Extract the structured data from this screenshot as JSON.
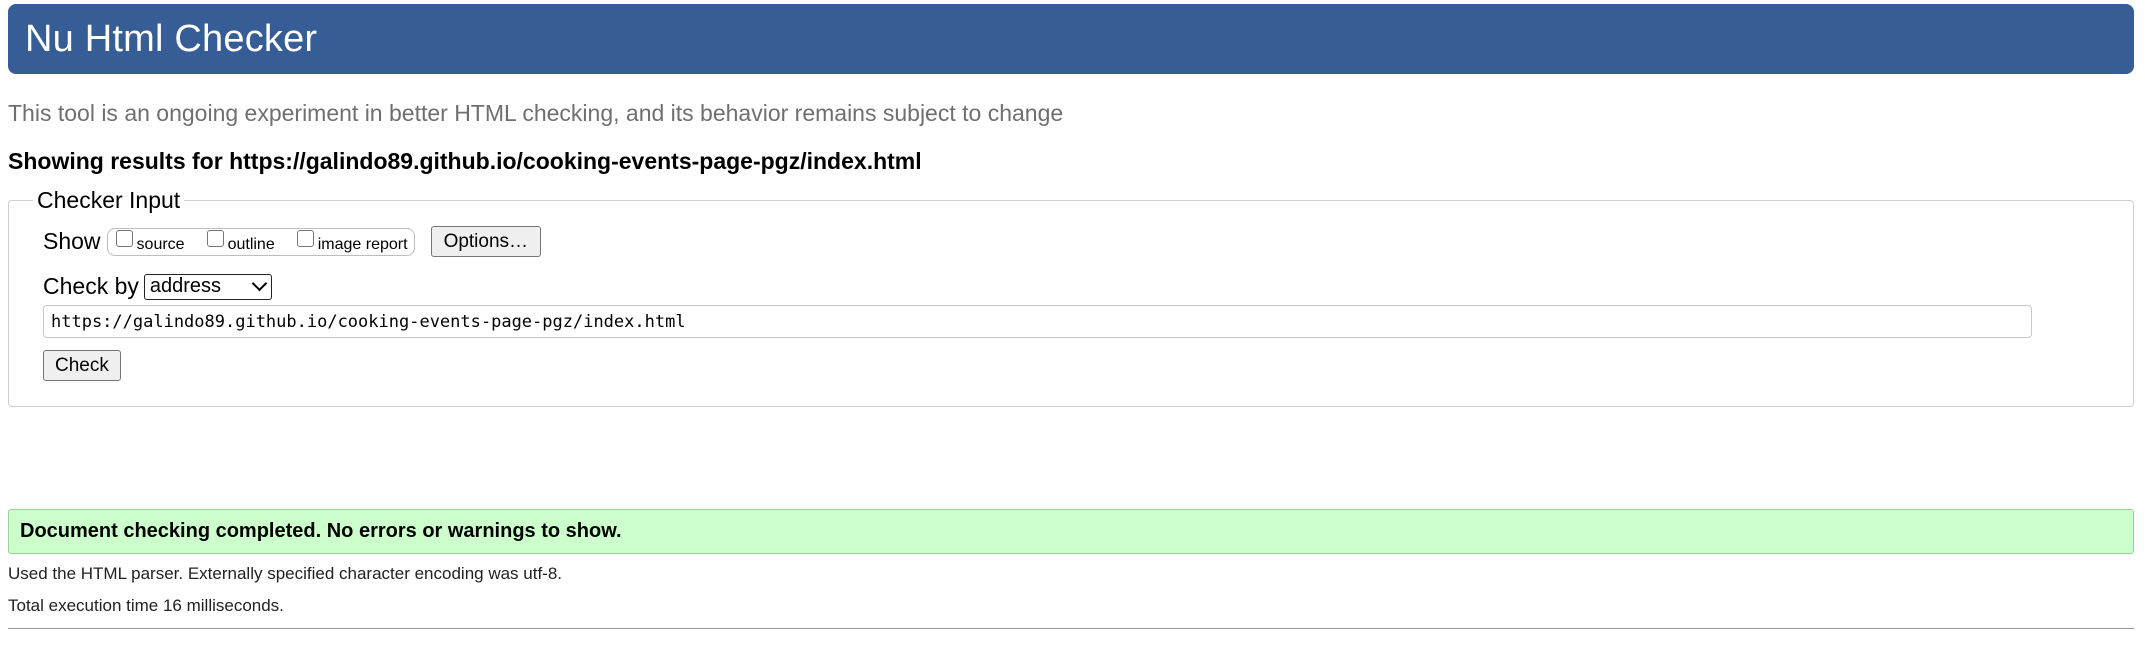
{
  "header": {
    "title": "Nu Html Checker",
    "color": "#365d95"
  },
  "tagline": "This tool is an ongoing experiment in better HTML checking, and its behavior remains subject to change",
  "showing_results": "Showing results for https://galindo89.github.io/cooking-events-page-pgz/index.html",
  "checker_input": {
    "legend": "Checker Input",
    "show_label": "Show",
    "options": [
      {
        "label": "source",
        "checked": false
      },
      {
        "label": "outline",
        "checked": false
      },
      {
        "label": "image report",
        "checked": false
      }
    ],
    "options_button": "Options…",
    "check_by_label": "Check by",
    "check_by_value": "address",
    "url_value": "https://galindo89.github.io/cooking-events-page-pgz/index.html",
    "check_button": "Check"
  },
  "result": {
    "message": "Document checking completed. No errors or warnings to show.",
    "color": "#ccffcc",
    "parser_info": "Used the HTML parser. Externally specified character encoding was utf-8.",
    "execution_time": "Total execution time 16 milliseconds."
  }
}
